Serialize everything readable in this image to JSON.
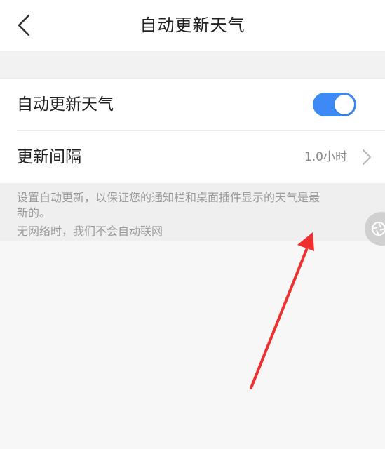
{
  "header": {
    "title": "自动更新天气",
    "back_icon": "chevron-left-icon"
  },
  "settings": {
    "auto_update": {
      "label": "自动更新天气",
      "enabled": true,
      "toggle_color": "#3d8af7"
    },
    "interval": {
      "label": "更新间隔",
      "value": "1.0小时",
      "icon": "chevron-right-icon"
    }
  },
  "note": {
    "line1": "设置自动更新，以保证您的通知栏和桌面插件显示的天气是最",
    "line2": "新的。",
    "line3": "无网络时，我们不会自动联网"
  },
  "annotation": {
    "arrow_color": "#f0302e",
    "icon": "red-arrow-icon"
  }
}
